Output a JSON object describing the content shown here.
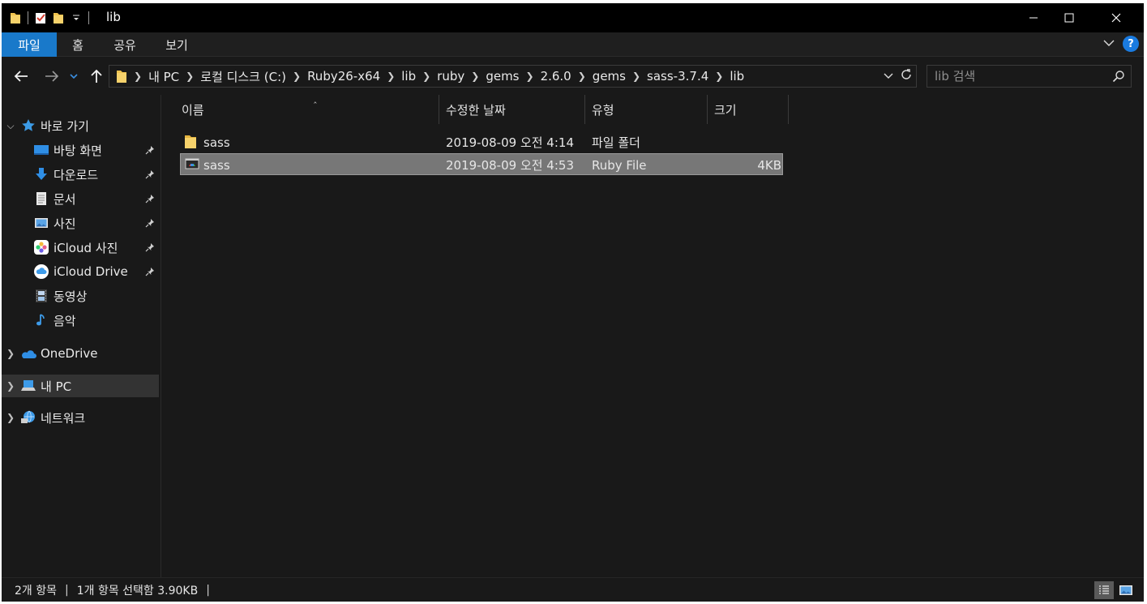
{
  "window": {
    "title": "lib"
  },
  "ribbon": {
    "tabs": [
      {
        "label": "파일",
        "active": true
      },
      {
        "label": "홈"
      },
      {
        "label": "공유"
      },
      {
        "label": "보기"
      }
    ]
  },
  "address": {
    "crumbs": [
      "내 PC",
      "로컬 디스크 (C:)",
      "Ruby26-x64",
      "lib",
      "ruby",
      "gems",
      "2.6.0",
      "gems",
      "sass-3.7.4",
      "lib"
    ]
  },
  "search": {
    "placeholder": "lib 검색"
  },
  "sidebar": {
    "quick_access": "바로 가기",
    "items": [
      {
        "label": "바탕 화면",
        "icon": "desktop-icon",
        "pinned": true
      },
      {
        "label": "다운로드",
        "icon": "download-icon",
        "pinned": true
      },
      {
        "label": "문서",
        "icon": "document-icon",
        "pinned": true
      },
      {
        "label": "사진",
        "icon": "pictures-icon",
        "pinned": true
      },
      {
        "label": "iCloud 사진",
        "icon": "icloud-photos-icon",
        "pinned": true
      },
      {
        "label": "iCloud Drive",
        "icon": "icloud-drive-icon",
        "pinned": true
      },
      {
        "label": "동영상",
        "icon": "videos-icon",
        "pinned": false
      },
      {
        "label": "음악",
        "icon": "music-icon",
        "pinned": false
      }
    ],
    "onedrive": "OneDrive",
    "this_pc": "내 PC",
    "network": "네트워크"
  },
  "columns": {
    "name": "이름",
    "modified": "수정한 날짜",
    "type": "유형",
    "size": "크기"
  },
  "files": [
    {
      "name": "sass",
      "modified": "2019-08-09 오전 4:14",
      "type": "파일 폴더",
      "size": "",
      "icon": "folder-icon"
    },
    {
      "name": "sass",
      "modified": "2019-08-09 오전 4:53",
      "type": "Ruby File",
      "size": "4KB",
      "icon": "ruby-file-icon",
      "selected": true
    }
  ],
  "status": {
    "count": "2개 항목",
    "selection": "1개 항목 선택함 3.90KB"
  },
  "colors": {
    "accent": "#1979ca",
    "selection": "#777777",
    "background": "#191919"
  }
}
